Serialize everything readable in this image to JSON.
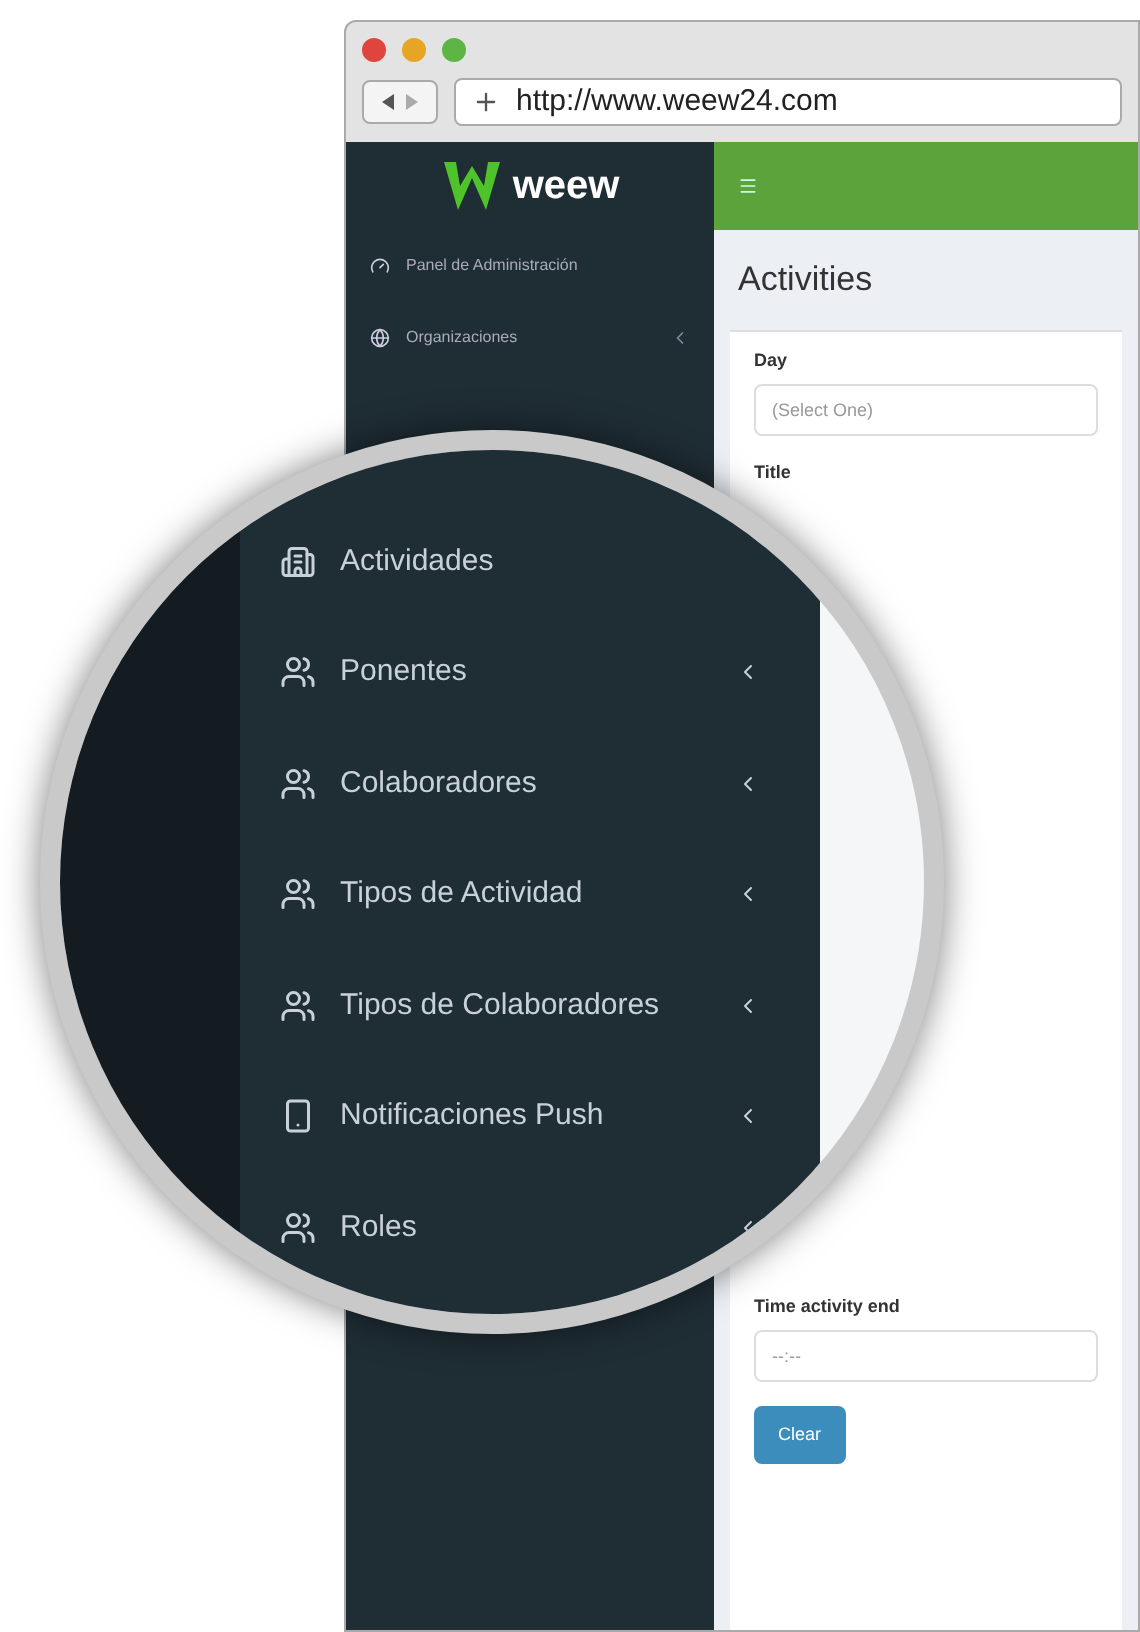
{
  "browser": {
    "url": "http://www.weew24.com"
  },
  "logo": {
    "text": "weew"
  },
  "sidebar": {
    "items": [
      {
        "label": "Panel de Administración",
        "submenu": false
      },
      {
        "label": "Organizaciones",
        "submenu": true
      }
    ]
  },
  "magnifier": {
    "items": [
      {
        "label": "Actividades",
        "submenu": false
      },
      {
        "label": "Ponentes",
        "submenu": true
      },
      {
        "label": "Colaboradores",
        "submenu": true
      },
      {
        "label": "Tipos de Actividad",
        "submenu": true
      },
      {
        "label": "Tipos de Colaboradores",
        "submenu": true
      },
      {
        "label": "Notificaciones Push",
        "submenu": true
      },
      {
        "label": "Roles",
        "submenu": true
      }
    ]
  },
  "page": {
    "title": "Activities",
    "fields_top": [
      {
        "label": "Day",
        "placeholder": "(Select One)"
      },
      {
        "label": "Title"
      }
    ],
    "fields_bottom": [
      {
        "label": "Time activity end",
        "placeholder": "--:--"
      }
    ],
    "button": "Clear"
  }
}
